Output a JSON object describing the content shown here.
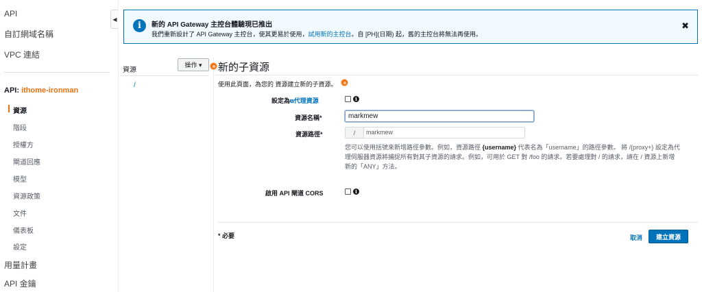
{
  "sidebar": {
    "top_items": [
      {
        "label": "API"
      },
      {
        "label": "自訂網域名稱"
      },
      {
        "label": "VPC 連結"
      }
    ],
    "api_prefix": "API: ",
    "api_name": "ithome-ironman",
    "sub_items": [
      {
        "label": "資源",
        "active": true
      },
      {
        "label": "階段"
      },
      {
        "label": "授權方"
      },
      {
        "label": "閘道回應"
      },
      {
        "label": "模型"
      },
      {
        "label": "資源政策"
      },
      {
        "label": "文件"
      },
      {
        "label": "儀表板"
      },
      {
        "label": "設定"
      }
    ],
    "bottom_items": [
      {
        "label": "用量計畫"
      },
      {
        "label": "API 金鑰"
      }
    ],
    "collapse_glyph": "◀"
  },
  "banner": {
    "icon": "info-icon",
    "title": "新的 API Gateway 主控台體驗現已推出",
    "body_before": "我們重新設計了 API Gateway 主控台，使其更易於使用，",
    "link": "試用新的主控台",
    "body_after": "。自 [PH](日期) 起，舊的主控台將無法再使用。",
    "close_glyph": "✖"
  },
  "resources": {
    "label": "資源",
    "actions_label": "操作 ▾",
    "root_path": "/"
  },
  "main": {
    "title": "新的子資源",
    "description": "使用此頁面，為您的 資源建立新的子資源。",
    "proxy_label_prefix": "設定為",
    "proxy_label_link": "代理資源",
    "resource_name_label": "資源名稱*",
    "resource_name_value": "markmew",
    "resource_path_label": "資源路徑*",
    "resource_path_prefix": "/",
    "resource_path_value": "markmew",
    "help_line1_before": "您可以使用括號來新增路徑參數。例如，資源路徑 ",
    "help_param": "{username}",
    "help_line1_after": " 代表名為「username」的路徑參數。 將 /{proxy+} 設定為代",
    "help_line2": "理伺服器資源將捕捉所有對其子資源的請求。例如，可用於 GET 對 /foo 的請求。若要處理對 / 的請求，請在 / 資源上新增",
    "help_line3": "新的「ANY」方法。",
    "cors_label": "啟用 API 閘道 CORS",
    "required_note": "* 必要",
    "cancel_label": "取消",
    "create_label": "建立資源"
  },
  "colors": {
    "accent_orange": "#ec7211",
    "link_blue": "#0073bb",
    "banner_bg": "#f1faff"
  }
}
